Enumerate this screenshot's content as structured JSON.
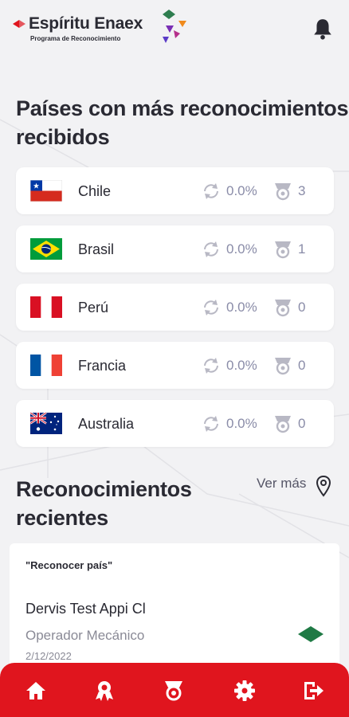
{
  "brand": {
    "title": "Espíritu Enaex",
    "subtitle": "Programa de Reconocimiento"
  },
  "countries_section": {
    "title_line1": "Países con más reconocimientos",
    "title_line2": "recibidos",
    "items": [
      {
        "name": "Chile",
        "pct": "0.0%",
        "count": "3",
        "flag": "chile"
      },
      {
        "name": "Brasil",
        "pct": "0.0%",
        "count": "1",
        "flag": "brazil"
      },
      {
        "name": "Perú",
        "pct": "0.0%",
        "count": "0",
        "flag": "peru"
      },
      {
        "name": "Francia",
        "pct": "0.0%",
        "count": "0",
        "flag": "france"
      },
      {
        "name": "Australia",
        "pct": "0.0%",
        "count": "0",
        "flag": "australia"
      }
    ]
  },
  "recent_section": {
    "title_line1": "Reconocimientos",
    "title_line2": "recientes",
    "ver_mas": "Ver más",
    "card": {
      "tag": "\"Reconocer país\"",
      "name": "Dervis Test Appi Cl",
      "role": "Operador Mecánico",
      "date": "2/12/2022"
    }
  },
  "nav": {
    "items": [
      "home-icon",
      "award-icon",
      "medal-icon",
      "gear-icon",
      "logout-icon"
    ]
  },
  "colors": {
    "accent": "#e0151e",
    "background": "#f2f2f4",
    "muted_text": "#8a8ca8"
  }
}
